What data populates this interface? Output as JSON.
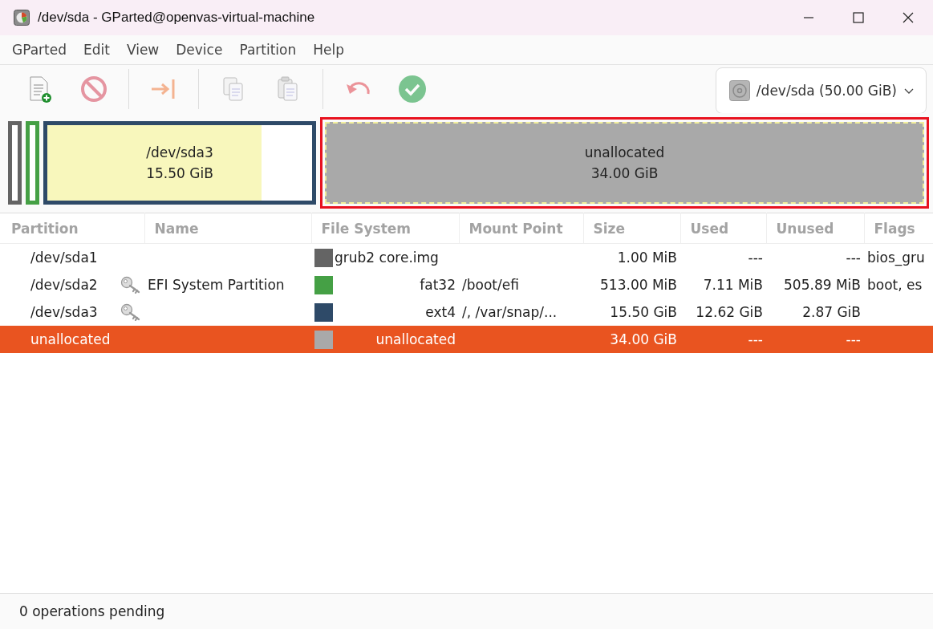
{
  "window": {
    "title": "/dev/sda - GParted@openvas-virtual-machine"
  },
  "menu": [
    "GParted",
    "Edit",
    "View",
    "Device",
    "Partition",
    "Help"
  ],
  "toolbar": [
    {
      "kind": "new",
      "disabled": false
    },
    {
      "kind": "delete",
      "disabled": true
    },
    {
      "kind": "separator"
    },
    {
      "kind": "resize",
      "disabled": true
    },
    {
      "kind": "separator"
    },
    {
      "kind": "copy",
      "disabled": true
    },
    {
      "kind": "paste",
      "disabled": true
    },
    {
      "kind": "separator"
    },
    {
      "kind": "undo",
      "disabled": true
    },
    {
      "kind": "apply",
      "disabled": true
    }
  ],
  "device_selector": {
    "value": "/dev/sda (50.00 GiB)"
  },
  "disk_map": [
    {
      "kind": "sliver",
      "color": "#646464"
    },
    {
      "kind": "sliver",
      "color": "#45a045"
    },
    {
      "kind": "partition",
      "color": "#2e4a68",
      "name": "/dev/sda3",
      "size": "15.50 GiB",
      "level": 0.81
    },
    {
      "kind": "unallocated",
      "color": "#a9a9a9",
      "name": "unallocated",
      "size": "34.00 GiB",
      "selected": true,
      "highlighted": true
    }
  ],
  "table": {
    "columns": [
      "Partition",
      "Name",
      "File System",
      "Mount Point",
      "Size",
      "Used",
      "Unused",
      "Flags"
    ],
    "rows": [
      {
        "partition": "/dev/sda1",
        "locked": false,
        "color": "#646464",
        "file_system": "grub2 core.img",
        "size": "1.00 MiB",
        "used": "---",
        "unused": "---",
        "flags": "bios_gru",
        "selected": false
      },
      {
        "partition": "/dev/sda2",
        "locked": true,
        "name": "EFI System Partition",
        "color": "#45a045",
        "file_system": "fat32",
        "mount_point": "/boot/efi",
        "size": "513.00 MiB",
        "used": "7.11 MiB",
        "unused": "505.89 MiB",
        "flags": "boot, es",
        "selected": false
      },
      {
        "partition": "/dev/sda3",
        "locked": true,
        "color": "#2e4a68",
        "file_system": "ext4",
        "mount_point": "/, /var/snap/...",
        "size": "15.50 GiB",
        "used": "12.62 GiB",
        "unused": "2.87 GiB",
        "selected": false
      },
      {
        "partition": "unallocated",
        "locked": false,
        "color": "#a9a9a9",
        "file_system": "unallocated",
        "size": "34.00 GiB",
        "used": "---",
        "unused": "---",
        "selected": true
      }
    ]
  },
  "status_bar": "0 operations pending"
}
